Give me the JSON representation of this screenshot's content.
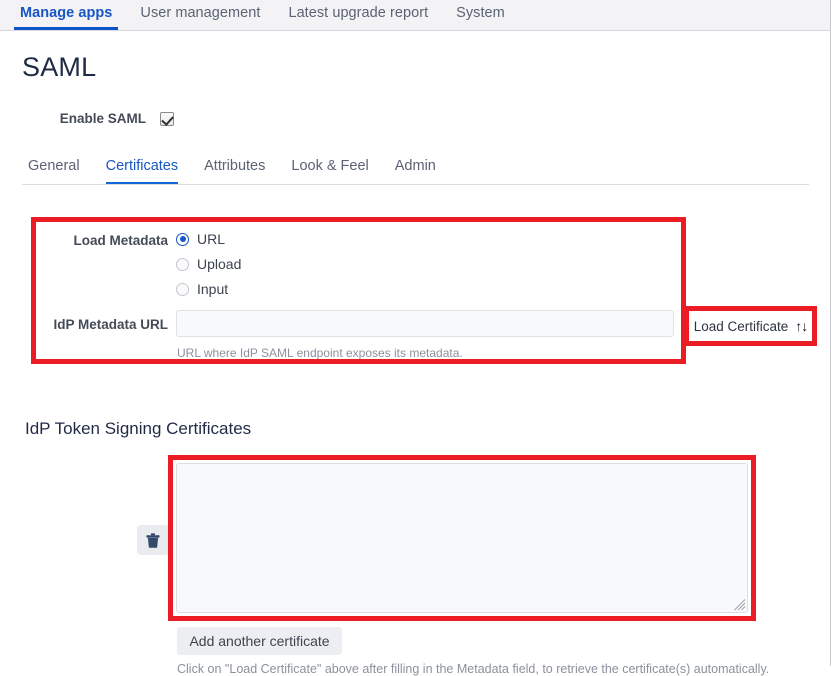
{
  "topnav": {
    "tabs": [
      {
        "label": "Manage apps",
        "active": true
      },
      {
        "label": "User management",
        "active": false
      },
      {
        "label": "Latest upgrade report",
        "active": false
      },
      {
        "label": "System",
        "active": false
      }
    ]
  },
  "page": {
    "title": "SAML",
    "enable_saml": {
      "label": "Enable SAML",
      "checked": true
    },
    "subtabs": [
      {
        "label": "General",
        "active": false
      },
      {
        "label": "Certificates",
        "active": true
      },
      {
        "label": "Attributes",
        "active": false
      },
      {
        "label": "Look & Feel",
        "active": false
      },
      {
        "label": "Admin",
        "active": false
      }
    ],
    "metadata": {
      "load_metadata_label": "Load Metadata",
      "options": [
        {
          "label": "URL",
          "selected": true
        },
        {
          "label": "Upload",
          "selected": false
        },
        {
          "label": "Input",
          "selected": false
        }
      ],
      "idp_url_label": "IdP Metadata URL",
      "idp_url_value": "",
      "idp_url_placeholder": "",
      "idp_url_hint": "URL where IdP SAML endpoint exposes its metadata.",
      "load_certificate_label": "Load Certificate",
      "load_certificate_icon": "up-down-arrows-icon",
      "load_certificate_glyph": "↑↓"
    },
    "certificates": {
      "section_title": "IdP Token Signing Certificates",
      "delete_icon": "trash-icon",
      "certificate_value": "",
      "certificate_placeholder": "",
      "add_button_label": "Add another certificate",
      "hint": "Click on \"Load Certificate\" above after filling in the Metadata field, to retrieve the certificate(s) automatically."
    }
  },
  "annotations": {
    "highlight_color": "#ec1c24",
    "boxes": [
      {
        "name": "metadata-region-highlight"
      },
      {
        "name": "load-certificate-highlight"
      },
      {
        "name": "certificate-textarea-highlight"
      }
    ]
  },
  "colors": {
    "accent_blue": "#1856c4",
    "nav_background": "#f3f3f5",
    "field_background": "#f8f9fb"
  }
}
